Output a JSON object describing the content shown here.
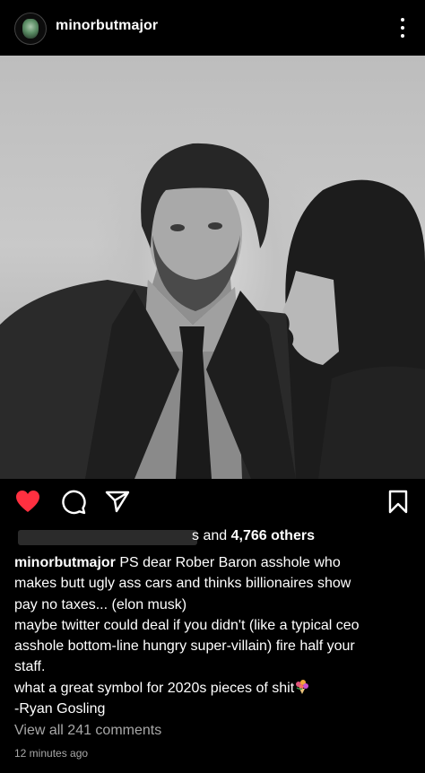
{
  "post": {
    "username": "minorbutmajor",
    "likes_text_prefix": "s and",
    "likes_count": "4,766 others",
    "caption_username": "minorbutmajor",
    "caption_lines": [
      "PS  dear Rober Baron asshole who",
      "makes butt ugly ass cars and thinks billionaires show",
      "pay no taxes... (elon musk)",
      "maybe twitter could deal if you didn't (like a typical ceo",
      "asshole bottom-line hungry super-villain)  fire half your",
      "staff.",
      "what a great symbol for 2020s pieces of shit",
      "-Ryan Gosling"
    ],
    "view_all_comments": "View all 241 comments",
    "timestamp": "12 minutes ago"
  },
  "icons": {
    "like": "heart-icon",
    "comment": "comment-icon",
    "share": "share-icon",
    "save": "bookmark-icon",
    "more": "more-vertical-icon",
    "emoji": "bouquet-emoji"
  },
  "colors": {
    "background": "#000000",
    "like_red": "#ff3040",
    "secondary_text": "#a8a8a8"
  }
}
